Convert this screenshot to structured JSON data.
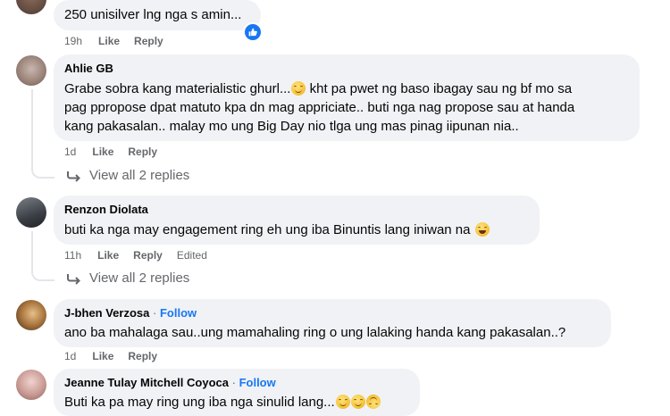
{
  "comments": [
    {
      "text_lines": [
        "250 unisilver lng nga s amin..."
      ],
      "time": "19h",
      "like_label": "Like",
      "reply_label": "Reply"
    },
    {
      "author": "Ahlie GB",
      "text_lines": [
        "Grabe sobra kang materialistic ghurl...",
        " kht pa pwet ng baso ibagay sau ng bf mo sa",
        "pag ppropose dpat matuto kpa dn mag appriciate.. buti nga nag propose sau at handa",
        "kang pakasalan.. malay mo ung Big Day nio tlga ung mas pinag iipunan nia.."
      ],
      "time": "1d",
      "like_label": "Like",
      "reply_label": "Reply",
      "view_replies": "View all 2 replies"
    },
    {
      "author": "Renzon Diolata",
      "text_lines": [
        "buti ka nga may engagement ring eh ung iba Binuntis lang iniwan na "
      ],
      "time": "11h",
      "like_label": "Like",
      "reply_label": "Reply",
      "edited_label": "Edited",
      "view_replies": "View all 2 replies"
    },
    {
      "author": "J-bhen Verzosa",
      "follow_label": "Follow",
      "text_lines": [
        "ano ba mahalaga sau..ung mamahaling ring o ung lalaking handa kang pakasalan..?"
      ],
      "time": "1d",
      "like_label": "Like",
      "reply_label": "Reply"
    },
    {
      "author": "Jeanne Tulay Mitchell Coyoca",
      "follow_label": "Follow",
      "text_lines": [
        "Buti ka pa may ring ung iba nga sinulid lang..."
      ]
    }
  ],
  "separator": "·",
  "colors": {
    "bubble": "#f0f2f5",
    "meta": "#65676b",
    "link": "#1877f2"
  },
  "icons": {
    "like_reaction": "thumbs-up-icon",
    "reply_arrow": "reply-arrow-icon",
    "emoji_grin": "grinning-emoji-icon",
    "emoji_laugh": "laughing-emoji-icon",
    "emoji_upside": "upside-down-emoji-icon"
  }
}
